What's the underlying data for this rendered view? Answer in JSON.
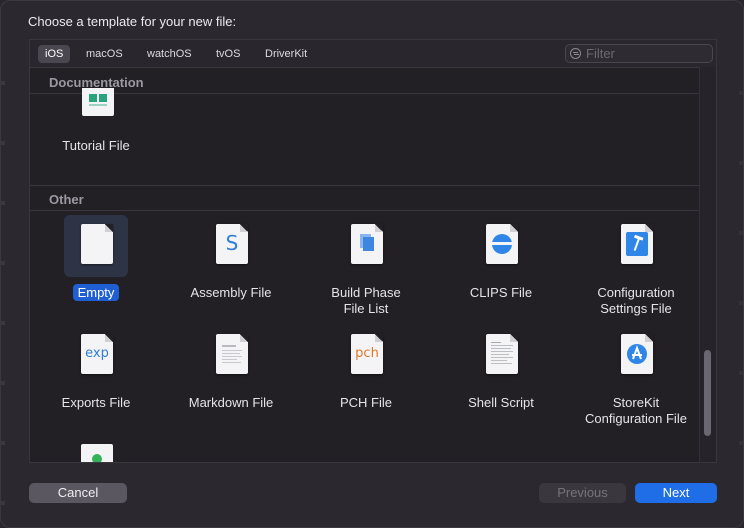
{
  "dialog": {
    "title": "Choose a template for your new file:"
  },
  "tabs": [
    {
      "label": "iOS",
      "active": true
    },
    {
      "label": "macOS"
    },
    {
      "label": "watchOS"
    },
    {
      "label": "tvOS"
    },
    {
      "label": "DriverKit"
    }
  ],
  "filter": {
    "placeholder": "Filter",
    "value": ""
  },
  "sections": {
    "documentation": {
      "header": "Documentation",
      "items": [
        {
          "label": "Tutorial File",
          "icon": "tutorial-file-icon"
        }
      ]
    },
    "other": {
      "header": "Other",
      "items": [
        {
          "label": "Empty",
          "icon": "empty-file-icon",
          "selected": true
        },
        {
          "label": "Assembly File",
          "icon": "assembly-file-icon",
          "glyph": "S"
        },
        {
          "label": "Build Phase File List",
          "line1": "Build Phase",
          "line2": "File List",
          "icon": "build-phase-file-list-icon"
        },
        {
          "label": "CLIPS File",
          "icon": "clips-file-icon"
        },
        {
          "label": "Configuration Settings File",
          "line1": "Configuration",
          "line2": "Settings File",
          "icon": "configuration-settings-file-icon"
        },
        {
          "label": "Exports File",
          "icon": "exports-file-icon",
          "glyph": "exp"
        },
        {
          "label": "Markdown File",
          "icon": "markdown-file-icon"
        },
        {
          "label": "PCH File",
          "icon": "pch-file-icon",
          "glyph": "pch"
        },
        {
          "label": "Shell Script",
          "icon": "shell-script-icon"
        },
        {
          "label": "StoreKit Configuration File",
          "line1": "StoreKit",
          "line2": "Configuration File",
          "icon": "storekit-configuration-file-icon"
        }
      ]
    }
  },
  "buttons": {
    "cancel": "Cancel",
    "previous": "Previous",
    "next": "Next"
  },
  "colors": {
    "accent": "#1f6ee8",
    "selection": "#1f5fd1",
    "panel_bg": "#221f25"
  }
}
